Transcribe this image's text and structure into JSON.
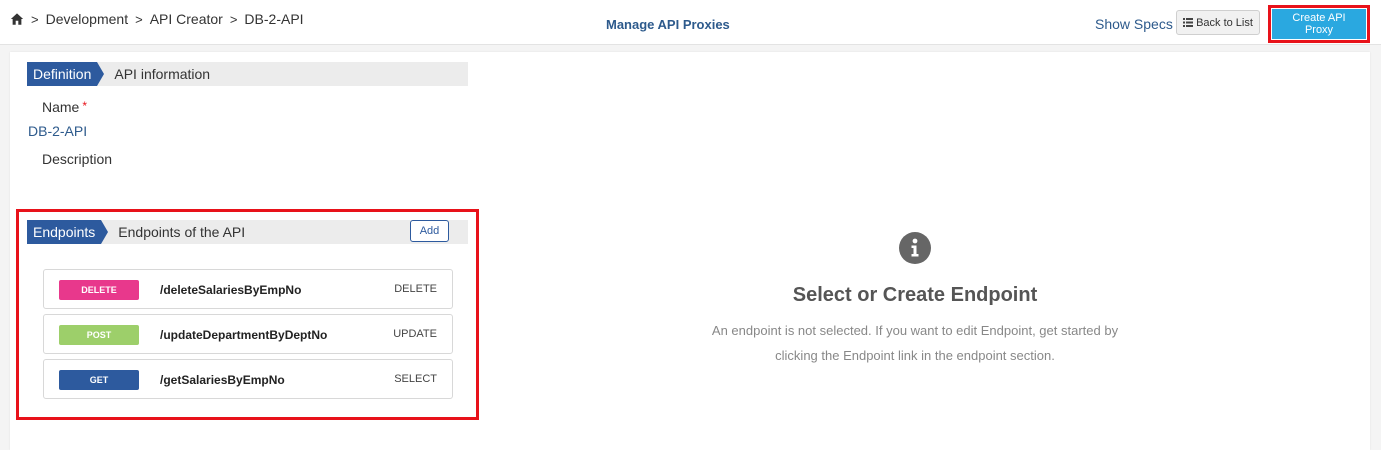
{
  "breadcrumb": {
    "items": [
      "Development",
      "API Creator",
      "DB-2-API"
    ],
    "separator": ">"
  },
  "header": {
    "title": "Manage API Proxies",
    "show_specs": "Show Specs",
    "back_to_list": "Back to List",
    "create_proxy": "Create API Proxy"
  },
  "definition": {
    "tag": "Definition",
    "subtitle": "API information",
    "name_label": "Name",
    "required_mark": "*",
    "name_value": "DB-2-API",
    "description_label": "Description"
  },
  "endpoints": {
    "tag": "Endpoints",
    "subtitle": "Endpoints of the API",
    "add_label": "Add",
    "items": [
      {
        "method": "DELETE",
        "path": "/deleteSalariesByEmpNo",
        "operation": "DELETE",
        "color": "#e8388c"
      },
      {
        "method": "POST",
        "path": "/updateDepartmentByDeptNo",
        "operation": "UPDATE",
        "color": "#9dcf6a"
      },
      {
        "method": "GET",
        "path": "/getSalariesByEmpNo",
        "operation": "SELECT",
        "color": "#2d5a9e"
      }
    ]
  },
  "empty_state": {
    "icon": "info-icon",
    "title": "Select or Create Endpoint",
    "message": "An endpoint is not selected. If you want to edit Endpoint, get started by clicking the Endpoint link in the endpoint section."
  },
  "colors": {
    "accent_blue": "#2d5a9e",
    "create_button": "#2aa8e0",
    "highlight_red": "#e8121a"
  }
}
